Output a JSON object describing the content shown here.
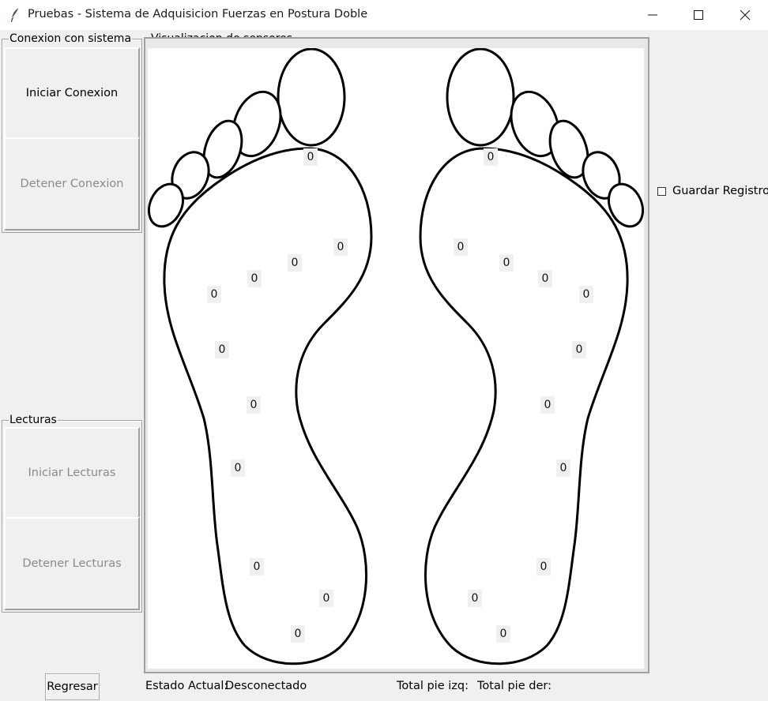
{
  "window": {
    "title": "Pruebas - Sistema de Adquisicion Fuerzas en Postura Doble",
    "icon": "feather-icon"
  },
  "conexion": {
    "title": "Conexion con sistema",
    "start_label": "Iniciar Conexion",
    "stop_label": "Detener Conexion"
  },
  "lecturas": {
    "title": "Lecturas",
    "start_label": "Iniciar Lecturas",
    "stop_label": "Detener Lecturas"
  },
  "visual": {
    "title": "Visualizacion de sensores",
    "left_foot_sensors": [
      "0",
      "0",
      "0",
      "0",
      "0",
      "0",
      "0",
      "0",
      "0",
      "0",
      "0",
      "0"
    ],
    "right_foot_sensors": [
      "0",
      "0",
      "0",
      "0",
      "0",
      "0",
      "0",
      "0",
      "0",
      "0",
      "0",
      "0"
    ]
  },
  "options": {
    "save_log_label": "Guardar Registro",
    "save_log_checked": false
  },
  "footer": {
    "back_label": "Regresar",
    "status_label": "Estado Actual:",
    "status_value": "Desconectado",
    "total_left_label": "Total pie izq:",
    "total_right_label": "Total pie der:"
  },
  "colors": {
    "window_bg": "#f0f0f0",
    "canvas_bg": "#ffffff",
    "disabled_text": "#8a8a8a"
  }
}
